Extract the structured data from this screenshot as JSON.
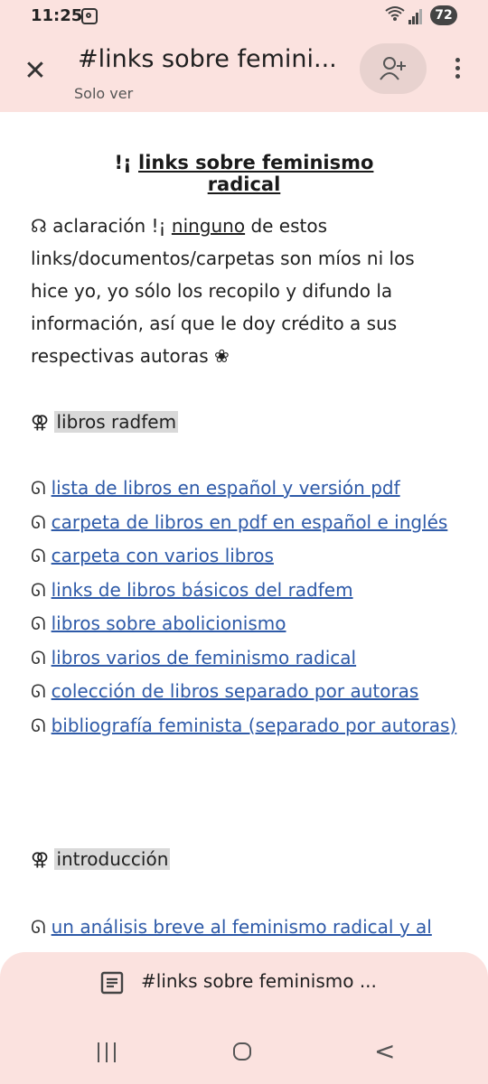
{
  "status_bar": {
    "time": "11:25",
    "battery": "72"
  },
  "app_bar": {
    "title": "#links sobre femini...",
    "subtitle": "Solo ver",
    "close_icon": "close-icon",
    "share_icon": "add-person-icon",
    "more_icon": "more-vert-icon"
  },
  "document": {
    "heading_prefix": "!¡ ",
    "heading": "links sobre feminismo radical",
    "intro": {
      "prefix": "☊ aclaración !¡ ",
      "underlined": "ninguno",
      "rest": " de estos links/documentos/carpetas son míos ni los hice yo, yo sólo los recopilo y difundo la información, así que le doy crédito a sus respectivas autoras ❀"
    },
    "sections": [
      {
        "symbol": "⚢ ",
        "label": "libros radfem",
        "links": [
          "lista de libros en español y versión pdf",
          "carpeta de libros en pdf en español e inglés",
          "carpeta con varios libros",
          "links de libros básicos del radfem",
          "libros sobre abolicionismo",
          "libros varios de feminismo radical",
          "colección de libros separado por autoras",
          "bibliografía feminista (separado por autoras)"
        ]
      },
      {
        "symbol": "⚢ ",
        "label": "introducción",
        "links": [
          "un análisis breve al feminismo radical y al"
        ]
      }
    ],
    "bullet": "ᘏ"
  },
  "bottom_sheet": {
    "title": "#links sobre feminismo ...",
    "icon": "document-outline-icon"
  },
  "nav": {
    "recent_icon": "recent-apps-icon",
    "home_icon": "home-icon",
    "back_icon": "back-icon",
    "back_glyph": "<"
  }
}
